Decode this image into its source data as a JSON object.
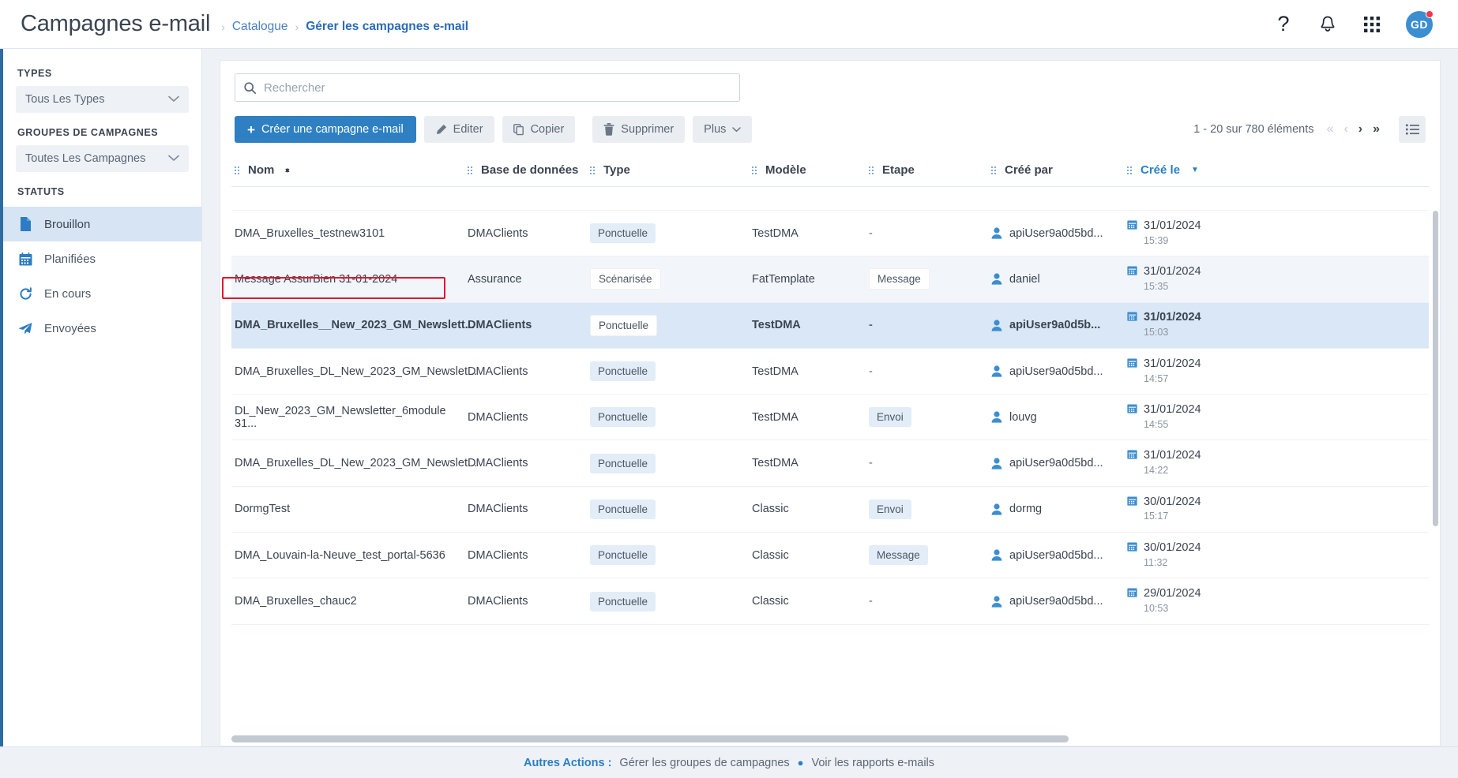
{
  "header": {
    "title": "Campagnes e-mail",
    "breadcrumb": [
      {
        "label": "Catalogue",
        "current": false
      },
      {
        "label": "Gérer les campagnes e-mail",
        "current": true
      }
    ],
    "help_icon": "question-mark-icon",
    "bell_icon": "bell-icon",
    "apps_icon": "grid-apps-icon",
    "avatar_initials": "GD"
  },
  "sidebar": {
    "types_title": "TYPES",
    "types_value": "Tous Les Types",
    "groups_title": "GROUPES DE CAMPAGNES",
    "groups_value": "Toutes Les Campagnes",
    "statuts_title": "STATUTS",
    "statuses": [
      {
        "label": "Brouillon",
        "icon": "document-icon",
        "active": true
      },
      {
        "label": "Planifiées",
        "icon": "calendar-icon",
        "active": false
      },
      {
        "label": "En cours",
        "icon": "refresh-icon",
        "active": false
      },
      {
        "label": "Envoyées",
        "icon": "paper-plane-icon",
        "active": false
      }
    ]
  },
  "search": {
    "placeholder": "Rechercher",
    "value": "",
    "icon": "search-icon"
  },
  "toolbar": {
    "create_label": "Créer une campagne e-mail",
    "edit_label": "Editer",
    "copy_label": "Copier",
    "delete_label": "Supprimer",
    "more_label": "Plus",
    "pagination_text": "1 - 20 sur 780 éléments",
    "first_page": "«",
    "prev_page": "‹",
    "next_page": "›",
    "last_page": "»",
    "view_toggle_icon": "list-view-icon"
  },
  "table": {
    "columns": [
      {
        "label": "Nom",
        "sorted": false,
        "sortable": true
      },
      {
        "label": "Base de données",
        "sorted": false,
        "sortable": false
      },
      {
        "label": "Type",
        "sorted": false,
        "sortable": false
      },
      {
        "label": "Modèle",
        "sorted": false,
        "sortable": false
      },
      {
        "label": "Etape",
        "sorted": false,
        "sortable": false
      },
      {
        "label": "Créé par",
        "sorted": false,
        "sortable": false
      },
      {
        "label": "Créé le",
        "sorted": true,
        "sortable": true
      }
    ],
    "rows": [
      {
        "nom": "DMA_Bruxelles_testnew3101",
        "base": "DMAClients",
        "type": "Ponctuelle",
        "modele": "TestDMA",
        "etape": "-",
        "cree_par": "apiUser9a0d5bd...",
        "date": "31/01/2024",
        "heure": "15:39"
      },
      {
        "nom": "Message AssurBien 31-01-2024",
        "base": "Assurance",
        "type": "Scénarisée",
        "modele": "FatTemplate",
        "etape": "Message",
        "cree_par": "daniel",
        "date": "31/01/2024",
        "heure": "15:35"
      },
      {
        "nom": "DMA_Bruxelles__New_2023_GM_Newslett...",
        "base": "DMAClients",
        "type": "Ponctuelle",
        "modele": "TestDMA",
        "etape": "-",
        "cree_par": "apiUser9a0d5b...",
        "date": "31/01/2024",
        "heure": "15:03"
      },
      {
        "nom": "DMA_Bruxelles_DL_New_2023_GM_Newslet...",
        "base": "DMAClients",
        "type": "Ponctuelle",
        "modele": "TestDMA",
        "etape": "-",
        "cree_par": "apiUser9a0d5bd...",
        "date": "31/01/2024",
        "heure": "14:57"
      },
      {
        "nom": "DL_New_2023_GM_Newsletter_6module 31...",
        "base": "DMAClients",
        "type": "Ponctuelle",
        "modele": "TestDMA",
        "etape": "Envoi",
        "cree_par": "louvg",
        "date": "31/01/2024",
        "heure": "14:55"
      },
      {
        "nom": "DMA_Bruxelles_DL_New_2023_GM_Newslet...",
        "base": "DMAClients",
        "type": "Ponctuelle",
        "modele": "TestDMA",
        "etape": "-",
        "cree_par": "apiUser9a0d5bd...",
        "date": "31/01/2024",
        "heure": "14:22"
      },
      {
        "nom": "DormgTest",
        "base": "DMAClients",
        "type": "Ponctuelle",
        "modele": "Classic",
        "etape": "Envoi",
        "cree_par": "dormg",
        "date": "30/01/2024",
        "heure": "15:17"
      },
      {
        "nom": "DMA_Louvain-la-Neuve_test_portal-5636",
        "base": "DMAClients",
        "type": "Ponctuelle",
        "modele": "Classic",
        "etape": "Message",
        "cree_par": "apiUser9a0d5bd...",
        "date": "30/01/2024",
        "heure": "11:32"
      },
      {
        "nom": "DMA_Bruxelles_chauc2",
        "base": "DMAClients",
        "type": "Ponctuelle",
        "modele": "Classic",
        "etape": "-",
        "cree_par": "apiUser9a0d5bd...",
        "date": "29/01/2024",
        "heure": "10:53"
      }
    ]
  },
  "footer": {
    "label": "Autres Actions :",
    "link1": "Gérer les groupes de campagnes",
    "bullet": "●",
    "link2": "Voir les rapports e-mails"
  },
  "colors": {
    "accent": "#2e80c2",
    "sidebar_active": "#d6e4f3",
    "selected_row": "#d9e7f6",
    "annotation": "#e4162b",
    "avatar": "#3b8ed0"
  }
}
